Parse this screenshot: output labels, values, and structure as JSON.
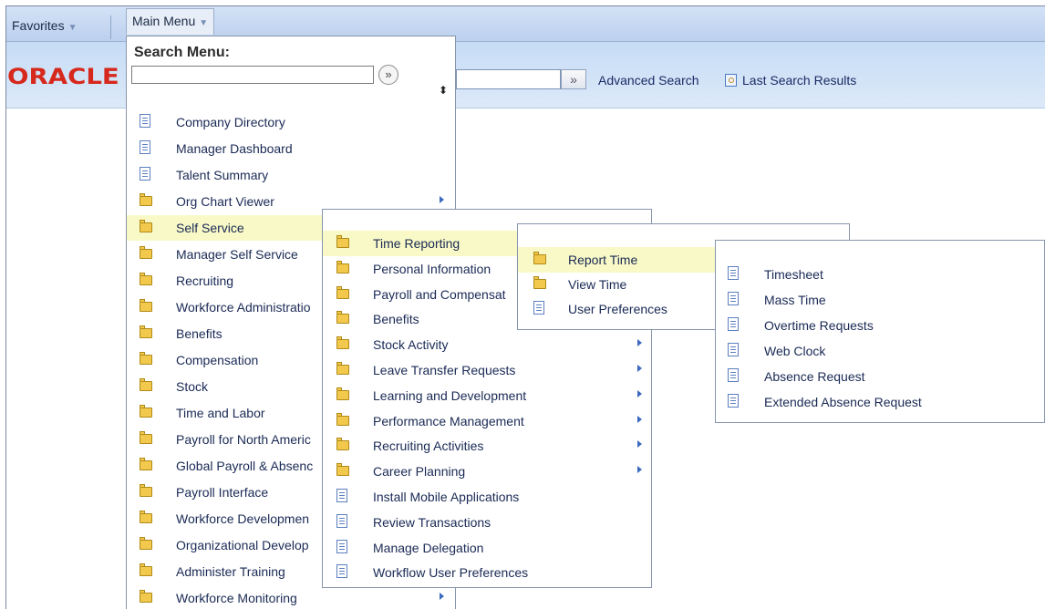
{
  "topbar": {
    "favorites": "Favorites",
    "main_menu": "Main Menu"
  },
  "navbar": {
    "logo": "ORACLE",
    "advanced_search": "Advanced Search",
    "last_search_results": "Last Search Results"
  },
  "search_menu": {
    "title": "Search Menu:"
  },
  "main_menu_items": [
    {
      "label": "Company Directory",
      "type": "doc"
    },
    {
      "label": "Manager Dashboard",
      "type": "doc"
    },
    {
      "label": "Talent Summary",
      "type": "doc"
    },
    {
      "label": "Org Chart Viewer",
      "type": "folder"
    },
    {
      "label": "Self Service",
      "type": "folder",
      "highlight": true
    },
    {
      "label": "Manager Self Service",
      "type": "folder"
    },
    {
      "label": "Recruiting",
      "type": "folder"
    },
    {
      "label": "Workforce Administratio",
      "type": "folder"
    },
    {
      "label": "Benefits",
      "type": "folder"
    },
    {
      "label": "Compensation",
      "type": "folder"
    },
    {
      "label": "Stock",
      "type": "folder"
    },
    {
      "label": "Time and Labor",
      "type": "folder"
    },
    {
      "label": "Payroll for North Americ",
      "type": "folder"
    },
    {
      "label": "Global Payroll & Absenc",
      "type": "folder"
    },
    {
      "label": "Payroll Interface",
      "type": "folder"
    },
    {
      "label": "Workforce Developmen",
      "type": "folder"
    },
    {
      "label": "Organizational Develop",
      "type": "folder"
    },
    {
      "label": "Administer Training",
      "type": "folder"
    },
    {
      "label": "Workforce Monitoring",
      "type": "folder"
    }
  ],
  "self_service_items": [
    {
      "label": "Time Reporting",
      "type": "folder",
      "highlight": true
    },
    {
      "label": "Personal Information",
      "type": "folder"
    },
    {
      "label": "Payroll and Compensat",
      "type": "folder"
    },
    {
      "label": "Benefits",
      "type": "folder"
    },
    {
      "label": "Stock Activity",
      "type": "folder"
    },
    {
      "label": "Leave Transfer Requests",
      "type": "folder"
    },
    {
      "label": "Learning and Development",
      "type": "folder"
    },
    {
      "label": "Performance Management",
      "type": "folder"
    },
    {
      "label": "Recruiting Activities",
      "type": "folder"
    },
    {
      "label": "Career Planning",
      "type": "folder"
    },
    {
      "label": "Install Mobile Applications",
      "type": "doc"
    },
    {
      "label": "Review Transactions",
      "type": "doc"
    },
    {
      "label": "Manage Delegation",
      "type": "doc"
    },
    {
      "label": "Workflow User Preferences",
      "type": "doc"
    }
  ],
  "time_reporting_items": [
    {
      "label": "Report Time",
      "type": "folder",
      "highlight": true
    },
    {
      "label": "View Time",
      "type": "folder"
    },
    {
      "label": "User Preferences",
      "type": "doc"
    }
  ],
  "report_time_items": [
    {
      "label": "Timesheet",
      "type": "doc"
    },
    {
      "label": "Mass Time",
      "type": "doc"
    },
    {
      "label": "Overtime Requests",
      "type": "doc"
    },
    {
      "label": "Web Clock",
      "type": "doc"
    },
    {
      "label": "Absence Request",
      "type": "doc"
    },
    {
      "label": "Extended Absence Request",
      "type": "doc"
    }
  ]
}
